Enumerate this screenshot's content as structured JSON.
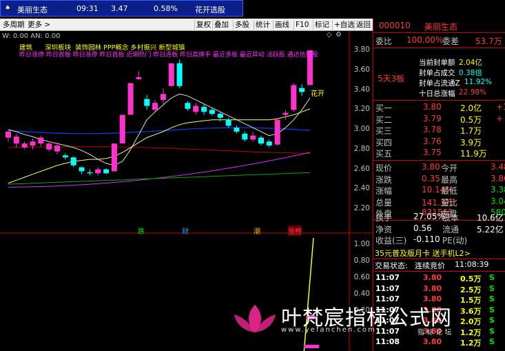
{
  "ticker": {
    "name": "美丽生态",
    "time": "09:31",
    "price": "3.47",
    "pct": "0.58%",
    "label": "花开选股"
  },
  "toolbar": {
    "period": "多周期",
    "more": "更多 >",
    "buttons": [
      "复权",
      "叠加",
      "多股",
      "统计",
      "画线",
      "F10",
      "标记",
      "+自选",
      "返回"
    ]
  },
  "chart": {
    "indicator_line": "W: 0.00  AN: 0.00",
    "concepts_row1": "建筑      深圳板块  装饰园林 PPP概念 乡村振兴 新型城镇",
    "concepts_row2": "昨日涨停 昨日首板 昨日涨停 昨日首板 近期热门 昨日连板 昨日高换手 最近多板 最近异动 活跃股 通达信热股",
    "price_labels": [
      "3.80",
      "3.60",
      "3.40",
      "3.20",
      "3.00",
      "2.80",
      "2.60",
      "2.40",
      "2.20"
    ],
    "lower_labels": [
      "1.00",
      "0.80",
      "0.60",
      "0.40",
      "0.20"
    ],
    "annotation": "花开",
    "markers": [
      "跌",
      "财",
      "潮",
      "涨榜"
    ],
    "candles": [
      {
        "o": 2.92,
        "c": 2.98,
        "h": 3.0,
        "l": 2.88
      },
      {
        "o": 2.86,
        "c": 2.93,
        "h": 2.96,
        "l": 2.82
      },
      {
        "o": 2.82,
        "c": 2.86,
        "h": 2.88,
        "l": 2.8
      },
      {
        "o": 2.84,
        "c": 2.88,
        "h": 2.91,
        "l": 2.8
      },
      {
        "o": 2.86,
        "c": 2.92,
        "h": 2.94,
        "l": 2.83
      },
      {
        "o": 2.8,
        "c": 2.86,
        "h": 2.88,
        "l": 2.78
      },
      {
        "o": 2.78,
        "c": 2.84,
        "h": 2.87,
        "l": 2.75
      },
      {
        "o": 2.74,
        "c": 2.72,
        "h": 2.76,
        "l": 2.7
      },
      {
        "o": 2.72,
        "c": 2.64,
        "h": 2.73,
        "l": 2.62
      },
      {
        "o": 2.62,
        "c": 2.58,
        "h": 2.63,
        "l": 2.55
      },
      {
        "o": 2.57,
        "c": 2.56,
        "h": 2.6,
        "l": 2.54
      },
      {
        "o": 2.56,
        "c": 2.6,
        "h": 2.62,
        "l": 2.54
      },
      {
        "o": 2.6,
        "c": 2.56,
        "h": 2.61,
        "l": 2.55
      },
      {
        "o": 2.58,
        "c": 2.86,
        "h": 2.86,
        "l": 2.58
      },
      {
        "o": 2.86,
        "c": 3.15,
        "h": 3.15,
        "l": 2.86
      },
      {
        "o": 3.15,
        "c": 3.47,
        "h": 3.47,
        "l": 3.15
      },
      {
        "o": 3.51,
        "c": 3.53,
        "h": 3.59,
        "l": 3.5
      },
      {
        "o": 3.31,
        "c": 3.24,
        "h": 3.35,
        "l": 3.2
      },
      {
        "o": 3.2,
        "c": 3.27,
        "h": 3.3,
        "l": 3.18
      },
      {
        "o": 3.3,
        "c": 3.36,
        "h": 3.42,
        "l": 3.24
      },
      {
        "o": 3.44,
        "c": 3.67,
        "h": 3.67,
        "l": 3.44
      },
      {
        "o": 3.67,
        "c": 3.44,
        "h": 3.71,
        "l": 3.42
      },
      {
        "o": 3.27,
        "c": 3.21,
        "h": 3.29,
        "l": 3.19
      },
      {
        "o": 3.18,
        "c": 3.24,
        "h": 3.27,
        "l": 3.15
      },
      {
        "o": 3.23,
        "c": 3.18,
        "h": 3.26,
        "l": 3.15
      },
      {
        "o": 3.2,
        "c": 3.16,
        "h": 3.22,
        "l": 3.14
      },
      {
        "o": 3.16,
        "c": 3.12,
        "h": 3.18,
        "l": 3.08
      },
      {
        "o": 3.1,
        "c": 3.04,
        "h": 3.12,
        "l": 3.02
      },
      {
        "o": 3.02,
        "c": 2.98,
        "h": 3.04,
        "l": 2.96
      },
      {
        "o": 2.96,
        "c": 2.9,
        "h": 2.98,
        "l": 2.88
      },
      {
        "o": 2.9,
        "c": 2.94,
        "h": 2.98,
        "l": 2.88
      },
      {
        "o": 2.92,
        "c": 2.86,
        "h": 2.94,
        "l": 2.84
      },
      {
        "o": 2.88,
        "c": 2.84,
        "h": 2.9,
        "l": 2.82
      },
      {
        "o": 2.85,
        "c": 3.1,
        "h": 3.12,
        "l": 2.84
      },
      {
        "o": 3.15,
        "c": 3.17,
        "h": 3.2,
        "l": 3.1
      },
      {
        "o": 3.2,
        "c": 3.45,
        "h": 3.47,
        "l": 3.18
      },
      {
        "o": 3.42,
        "c": 3.38,
        "h": 3.46,
        "l": 3.34
      },
      {
        "o": 3.45,
        "c": 3.8,
        "h": 3.8,
        "l": 3.45
      }
    ],
    "ma_white": [
      3.0,
      2.98,
      2.95,
      2.93,
      2.9,
      2.88,
      2.86,
      2.84,
      2.82,
      2.79,
      2.75,
      2.7,
      2.66,
      2.64,
      2.68,
      2.8,
      2.95,
      3.1,
      3.18,
      3.25,
      3.32,
      3.36,
      3.34,
      3.3,
      3.26,
      3.22,
      3.18,
      3.14,
      3.1,
      3.06,
      3.02,
      2.98,
      2.94,
      2.96,
      3.02,
      3.1,
      3.2,
      3.32
    ],
    "ma_yellow": [
      2.46,
      2.49,
      2.52,
      2.55,
      2.58,
      2.61,
      2.64,
      2.66,
      2.68,
      2.69,
      2.7,
      2.7,
      2.71,
      2.73,
      2.77,
      2.82,
      2.87,
      2.92,
      2.95,
      2.98,
      3.02,
      3.05,
      3.07,
      3.08,
      3.09,
      3.1,
      3.1,
      3.1,
      3.1,
      3.1,
      3.1,
      3.1,
      3.1,
      3.11,
      3.13,
      3.15,
      3.18,
      3.21
    ]
  },
  "panel": {
    "code": "000010",
    "name": "美丽生态",
    "weibi_label": "委比",
    "weibi_val": "100.00%",
    "weicha_label": "委差",
    "weicha_val": "53.7万",
    "streak": "5天3板",
    "seal_amount_label": "当前封单额",
    "seal_amount_val": "2.04亿",
    "seal_deal_label": "封单占成交",
    "seal_deal_val": "0.38倍",
    "seal_float_label": "封单占流通Z",
    "seal_float_val": "11.92%",
    "ten_day_label": "十日总涨幅",
    "ten_day_val": "22.98%",
    "bids": [
      {
        "label": "买一",
        "price": "3.80",
        "vol": "2.0亿",
        "chg": "+1"
      },
      {
        "label": "买二",
        "price": "3.79",
        "vol": "0.5万",
        "chg": "+"
      },
      {
        "label": "买三",
        "price": "3.78",
        "vol": "1.7万",
        "chg": ""
      },
      {
        "label": "买四",
        "price": "3.76",
        "vol": "3.9万",
        "chg": ""
      },
      {
        "label": "买五",
        "price": "3.75",
        "vol": "11.9万",
        "chg": ""
      }
    ],
    "stats": [
      {
        "l1": "现价",
        "v1": "3.80",
        "l2": "今开",
        "v2": "3.48"
      },
      {
        "l1": "涨跌",
        "v1": "0.35",
        "l2": "最高",
        "v2": "3.80"
      },
      {
        "l1": "涨幅",
        "v1": "10.14%",
        "l2": "最低",
        "v2": "3.38"
      },
      {
        "l1": "总量",
        "v1": "141.3万",
        "l2": "量比",
        "v2": "3.04"
      },
      {
        "l1": "外盘",
        "v1": "831565",
        "l2": "内盘",
        "v2": "580978"
      }
    ],
    "stats2": [
      {
        "l1": "换手",
        "v1": "27.05%",
        "l2": "股本",
        "v2": "10.6亿"
      },
      {
        "l1": "净资",
        "v1": "0.56",
        "l2": "流通",
        "v2": "5.22亿"
      },
      {
        "l1": "收益(三)",
        "v1": "-0.110",
        "l2": "PE(动)",
        "v2": ""
      }
    ],
    "promo": "35元普及版月卡 送手机L2>",
    "trade_status_label": "交易状态:",
    "trade_status_val": "连续竞价",
    "trade_time": "11:08:39",
    "ticks": [
      {
        "t": "11:07",
        "p": "3.80",
        "v": "0.5万",
        "s": "S"
      },
      {
        "t": "11:07",
        "p": "3.80",
        "v": "2.5万",
        "s": "S"
      },
      {
        "t": "11:07",
        "p": "3.80",
        "v": "1.5万",
        "s": "S"
      },
      {
        "t": "11:07",
        "p": "3.80",
        "v": "3.6万",
        "s": "S"
      },
      {
        "t": "11:07",
        "p": "3.80",
        "v": "2.0万",
        "s": "S"
      },
      {
        "t": "11:07",
        "p": "3.80",
        "v": "1.2万",
        "s": "S"
      },
      {
        "t": "11:08",
        "p": "3.80",
        "v": "1.2万",
        "s": "S"
      }
    ]
  },
  "watermark": {
    "title": "叶梵宸指标公式网",
    "url": "www.yefanchen.com",
    "sub": "指 标 论 坛"
  },
  "colors": {
    "up": "#ff3b3b",
    "down": "#00e600",
    "candle_up": "#ff33cc",
    "candle_down": "#00ffff",
    "ma_white": "#e0e0e0",
    "ma_yellow": "#ffff66",
    "ma_blue": "#0044ff",
    "ma_red": "#c00000",
    "ma_purple": "#cc33ff",
    "ma_green": "#00aa00"
  }
}
